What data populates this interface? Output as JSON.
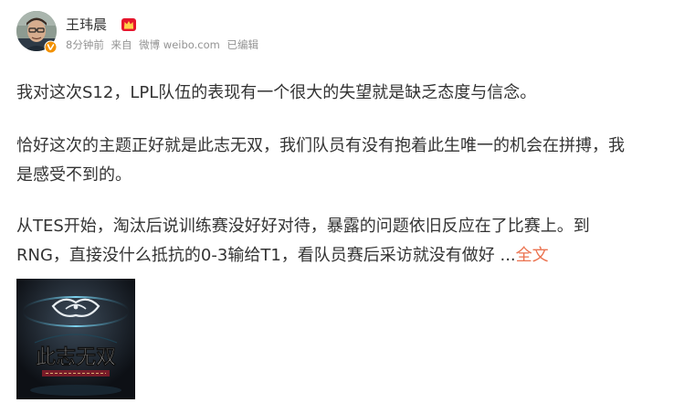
{
  "post": {
    "author": "王玮晨",
    "meta": {
      "time": "8分钟前",
      "source_prefix": "来自",
      "source": "微博 weibo.com",
      "status": "已编辑"
    },
    "paragraphs": {
      "p1": "我对这次S12，LPL队伍的表现有一个很大的失望就是缺乏态度与信念。",
      "p2": "恰好这次的主题正好就是此志无双，我们队员有没有抱着此生唯一的机会在拼搏，我是感受不到的。",
      "p3": "从TES开始，淘汰后说训练赛没好好对待，暴露的问题依旧反应在了比赛上。到RNG，直接没什么抵抗的0-3输给T1，看队员赛后采访就没有做好 ..."
    },
    "full_text_link": "全文",
    "image": {
      "title_text": "此志无双"
    }
  },
  "icons": {
    "avatar": "avatar-photo",
    "verify": "verified-badge-icon",
    "member": "member-crown-icon"
  },
  "colors": {
    "text": "#333333",
    "meta": "#939393",
    "link": "#eb7350",
    "badge_orange": "#f29100",
    "member_red": "#e6162d"
  }
}
